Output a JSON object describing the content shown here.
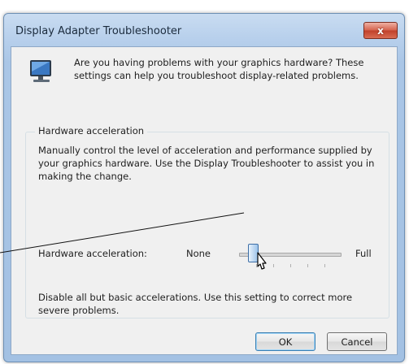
{
  "window": {
    "title": "Display Adapter Troubleshooter",
    "close_label": "x"
  },
  "intro": {
    "text": "Are you having problems with your graphics hardware? These settings can help you troubleshoot display-related problems.",
    "icon": "monitor-icon"
  },
  "group": {
    "label": "Hardware acceleration",
    "description": "Manually control the level of acceleration and performance supplied by your graphics hardware. Use the Display Troubleshooter to assist you in making the change."
  },
  "slider": {
    "label": "Hardware acceleration:",
    "min_label": "None",
    "max_label": "Full",
    "level": 0.1,
    "description": "Disable all but basic accelerations. Use this setting to correct more severe problems."
  },
  "buttons": {
    "ok": "OK",
    "cancel": "Cancel"
  },
  "colors": {
    "close_button": "#c9452f",
    "title_bar": "#b8d0ec",
    "slider_thumb": "#9cc3ea"
  }
}
